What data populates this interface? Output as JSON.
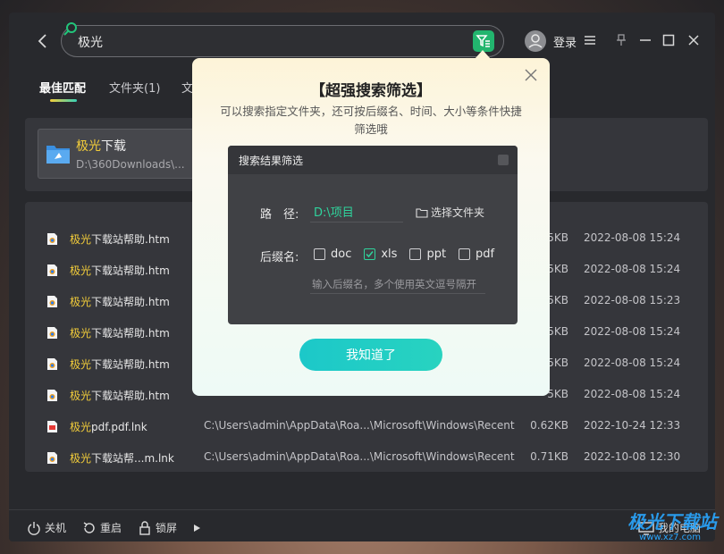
{
  "search": {
    "query": "极光"
  },
  "header": {
    "login_label": "登录"
  },
  "tabs": [
    {
      "label": "最佳匹配"
    },
    {
      "label": "文件夹(1)"
    },
    {
      "label": "文"
    }
  ],
  "best_match": {
    "name_highlight": "极光",
    "name_rest": "下载",
    "path": "D:\\360Downloads\\..."
  },
  "files": [
    {
      "icon": "html-file-icon",
      "name_hl": "极光",
      "name_rest": "下载站帮助.htm",
      "path": "",
      "size": "5KB",
      "date": "2022-08-08 15:24"
    },
    {
      "icon": "html-file-icon",
      "name_hl": "极光",
      "name_rest": "下载站帮助.htm",
      "path": "",
      "size": "5KB",
      "date": "2022-08-08 15:24"
    },
    {
      "icon": "html-file-icon",
      "name_hl": "极光",
      "name_rest": "下载站帮助.htm",
      "path": "",
      "size": "5KB",
      "date": "2022-08-08 15:23"
    },
    {
      "icon": "html-file-icon",
      "name_hl": "极光",
      "name_rest": "下载站帮助.htm",
      "path": "",
      "size": "5KB",
      "date": "2022-08-08 15:24"
    },
    {
      "icon": "html-file-icon",
      "name_hl": "极光",
      "name_rest": "下载站帮助.htm",
      "path": "",
      "size": "5KB",
      "date": "2022-08-08 15:24"
    },
    {
      "icon": "html-file-icon",
      "name_hl": "极光",
      "name_rest": "下载站帮助.htm",
      "path": "",
      "size": "5KB",
      "date": "2022-08-08 15:24"
    },
    {
      "icon": "pdf-file-icon",
      "name_hl": "极光",
      "name_rest": "pdf.pdf.lnk",
      "path": "C:\\Users\\admin\\AppData\\Roa...\\Microsoft\\Windows\\Recent",
      "size": "0.62KB",
      "date": "2022-10-24 12:33"
    },
    {
      "icon": "html-file-icon",
      "name_hl": "极光",
      "name_rest": "下载站帮...m.lnk",
      "path": "C:\\Users\\admin\\AppData\\Roa...\\Microsoft\\Windows\\Recent",
      "size": "0.71KB",
      "date": "2022-10-08 12:30"
    }
  ],
  "bottom": {
    "shutdown": "关机",
    "restart": "重启",
    "lock": "锁屏",
    "my_computer": "我的电脑"
  },
  "watermark": {
    "main": "极光下载站",
    "sub": "www.xz7.com"
  },
  "popup": {
    "title": "【超强搜索筛选】",
    "desc": "可以搜索指定文件夹，还可按后缀名、时间、大小等条件快捷筛选哦",
    "dialog_title": "搜索结果筛选",
    "path_label": "路　径:",
    "path_value": "D:\\项目",
    "choose_folder": "选择文件夹",
    "ext_label": "后缀名:",
    "ext_options": [
      {
        "label": "doc",
        "checked": false
      },
      {
        "label": "xls",
        "checked": true
      },
      {
        "label": "ppt",
        "checked": false
      },
      {
        "label": "pdf",
        "checked": false
      }
    ],
    "ext_placeholder": "输入后缀名，多个使用英文逗号隔开",
    "ok_label": "我知道了"
  },
  "colors": {
    "accent_green": "#22b56e",
    "highlight_yellow": "#f3cd3a",
    "teal_button": "#1cc8c9"
  }
}
